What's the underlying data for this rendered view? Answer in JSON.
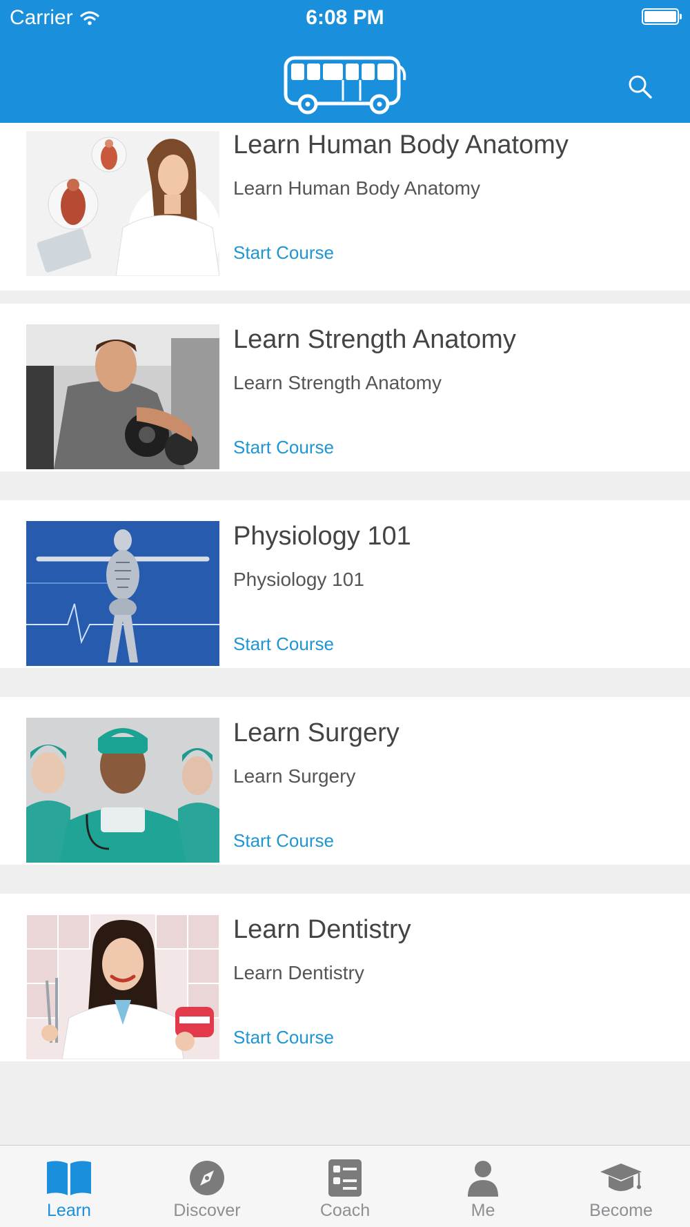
{
  "status_bar": {
    "carrier": "Carrier",
    "time": "6:08 PM"
  },
  "header": {
    "logo_icon": "bus-icon",
    "search_icon": "search-icon"
  },
  "colors": {
    "brand_blue": "#1a8fdb",
    "link_blue": "#1f95d3",
    "title_gray": "#444444",
    "tab_inactive": "#8e8e93"
  },
  "courses": [
    {
      "title": "Learn Human Body Anatomy",
      "subtitle": "Learn Human Body Anatomy",
      "action": "Start Course",
      "image": "doctor-with-anatomy-models"
    },
    {
      "title": "Learn Strength Anatomy",
      "subtitle": "Learn Strength Anatomy",
      "action": "Start Course",
      "image": "man-lifting-dumbbell"
    },
    {
      "title": "Physiology 101",
      "subtitle": "Physiology 101",
      "action": "Start Course",
      "image": "skeleton-figure-on-blue"
    },
    {
      "title": "Learn Surgery",
      "subtitle": "Learn Surgery",
      "action": "Start Course",
      "image": "surgeons-in-scrubs"
    },
    {
      "title": "Learn Dentistry",
      "subtitle": "Learn Dentistry",
      "action": "Start Course",
      "image": "dentist-holding-teeth-model"
    }
  ],
  "tabbar": {
    "selected": "Learn",
    "tabs": [
      {
        "label": "Learn",
        "icon": "book-icon"
      },
      {
        "label": "Discover",
        "icon": "compass-icon"
      },
      {
        "label": "Coach",
        "icon": "checklist-icon"
      },
      {
        "label": "Me",
        "icon": "person-icon"
      },
      {
        "label": "Become",
        "icon": "graduation-cap-icon"
      }
    ]
  }
}
